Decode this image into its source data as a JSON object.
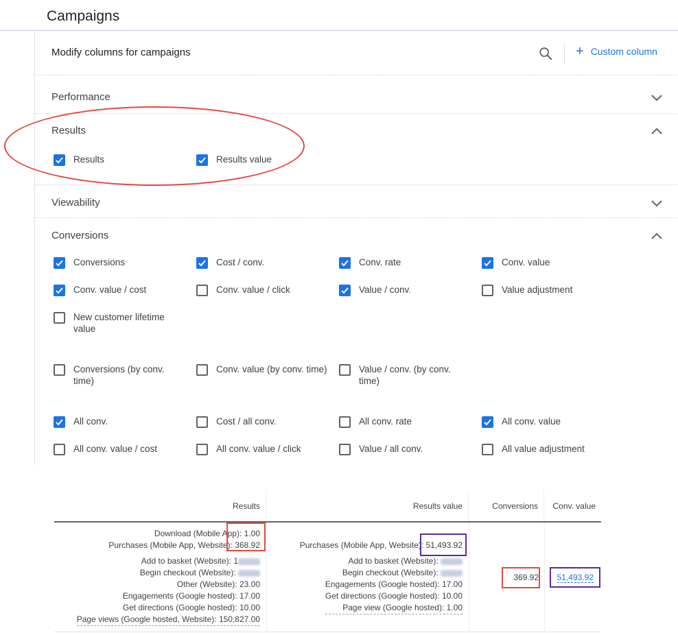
{
  "page": {
    "title": "Campaigns"
  },
  "modal": {
    "title": "Modify columns for campaigns",
    "custom_column_label": "Custom column"
  },
  "sections": {
    "performance": {
      "title": "Performance",
      "expanded": false
    },
    "results": {
      "title": "Results",
      "expanded": true,
      "options": [
        {
          "label": "Results",
          "checked": true
        },
        {
          "label": "Results value",
          "checked": true
        }
      ]
    },
    "viewability": {
      "title": "Viewability",
      "expanded": false
    },
    "conversions": {
      "title": "Conversions",
      "expanded": true,
      "options": [
        {
          "label": "Conversions",
          "checked": true
        },
        {
          "label": "Cost / conv.",
          "checked": true
        },
        {
          "label": "Conv. rate",
          "checked": true
        },
        {
          "label": "Conv. value",
          "checked": true
        },
        {
          "label": "Conv. value / cost",
          "checked": true
        },
        {
          "label": "Conv. value / click",
          "checked": false
        },
        {
          "label": "Value / conv.",
          "checked": true
        },
        {
          "label": "Value adjustment",
          "checked": false
        },
        {
          "label": "New customer lifetime value",
          "checked": false
        },
        {
          "label": "Conversions (by conv. time)",
          "checked": false
        },
        {
          "label": "Conv. value (by conv. time)",
          "checked": false
        },
        {
          "label": "Value / conv. (by conv. time)",
          "checked": false
        },
        {
          "label": "All conv.",
          "checked": true
        },
        {
          "label": "Cost / all conv.",
          "checked": false
        },
        {
          "label": "All conv. rate",
          "checked": false
        },
        {
          "label": "All conv. value",
          "checked": true
        },
        {
          "label": "All conv. value / cost",
          "checked": false
        },
        {
          "label": "All conv. value / click",
          "checked": false
        },
        {
          "label": "Value / all conv.",
          "checked": false
        },
        {
          "label": "All value adjustment",
          "checked": false
        }
      ]
    }
  },
  "table": {
    "headers": [
      "Results",
      "Results value",
      "Conversions",
      "Conv. value"
    ],
    "results_primary": [
      {
        "label": "Download (Mobile App)",
        "value": "1.00"
      },
      {
        "label": "Purchases (Mobile App, Website)",
        "value": "368.92"
      }
    ],
    "results_secondary": [
      {
        "label": "Add to basket (Website)",
        "value": "1",
        "redacted": true
      },
      {
        "label": "Begin checkout (Website)",
        "value": "",
        "redacted": true
      },
      {
        "label": "Other (Website)",
        "value": "23.00"
      },
      {
        "label": "Engagements (Google hosted)",
        "value": "17.00"
      },
      {
        "label": "Get directions (Google hosted)",
        "value": "10.00"
      },
      {
        "label": "Page views (Google hosted, Website)",
        "value": "150,827.00"
      }
    ],
    "results_value_primary": [
      {
        "label": "Purchases (Mobile App, Website)",
        "value": "51,493.92"
      }
    ],
    "results_value_secondary": [
      {
        "label": "Add to basket (Website)",
        "value": "",
        "redacted": true
      },
      {
        "label": "Begin checkout (Website)",
        "value": "",
        "redacted": true
      },
      {
        "label": "Engagements (Google hosted)",
        "value": "17.00"
      },
      {
        "label": "Get directions (Google hosted)",
        "value": "10.00"
      },
      {
        "label": "Page view (Google hosted)",
        "value": "1.00"
      }
    ],
    "conversions_value": "369.92",
    "conv_value": "51,493.92"
  },
  "colors": {
    "accent": "#1a73e8",
    "annotation_red": "#e8453c",
    "annotation_purple": "#5b2a9c"
  }
}
